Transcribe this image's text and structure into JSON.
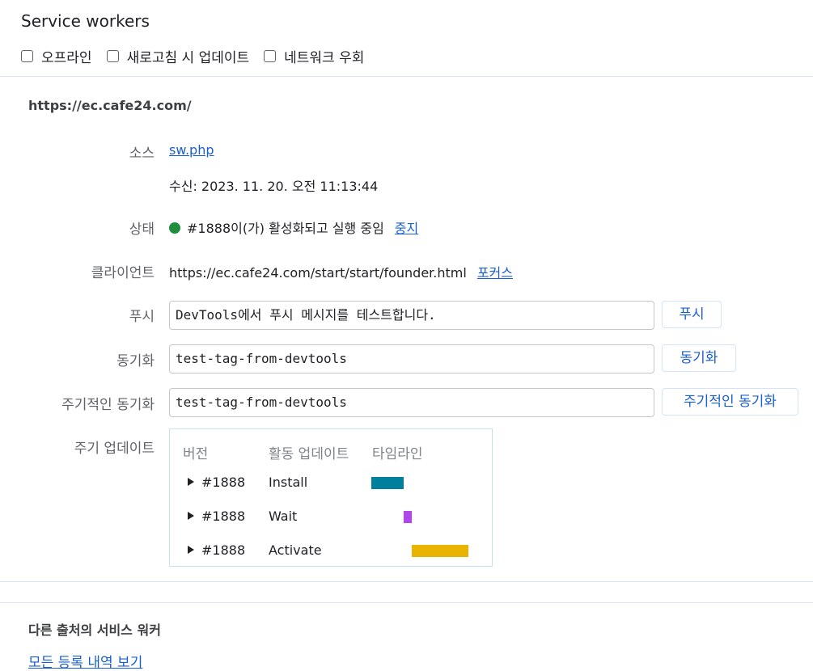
{
  "header": {
    "title": "Service workers",
    "checkboxes": [
      {
        "label": "오프라인"
      },
      {
        "label": "새로고침 시 업데이트"
      },
      {
        "label": "네트워크 우회"
      }
    ]
  },
  "worker": {
    "origin": "https://ec.cafe24.com/",
    "source_label": "소스",
    "source_link": "sw.php",
    "received": "수신: 2023. 11. 20. 오전 11:13:44",
    "status_label": "상태",
    "status_text": "#1888이(가) 활성화되고 실행 중임",
    "status_link": "중지",
    "status_color": "#1e8e3e",
    "clients_label": "클라이언트",
    "clients_url": "https://ec.cafe24.com/start/start/founder.html",
    "clients_link": "포커스",
    "push_label": "푸시",
    "push_value": "DevTools에서 푸시 메시지를 테스트합니다.",
    "push_button": "푸시",
    "sync_label": "동기화",
    "sync_value": "test-tag-from-devtools",
    "sync_button": "동기화",
    "periodic_label": "주기적인 동기화",
    "periodic_value": "test-tag-from-devtools",
    "periodic_button": "주기적인 동기화",
    "update_label": "주기 업데이트"
  },
  "timeline": {
    "headers": [
      "버전",
      "활동 업데이트",
      "타임라인"
    ],
    "rows": [
      {
        "version": "#1888",
        "activity": "Install",
        "color": "#00809d"
      },
      {
        "version": "#1888",
        "activity": "Wait",
        "color": "#b145f0"
      },
      {
        "version": "#1888",
        "activity": "Activate",
        "color": "#e8b400"
      }
    ]
  },
  "footer": {
    "other_title": "다른 출처의 서비스 워커",
    "all_link": "모든 등록 내역 보기"
  }
}
